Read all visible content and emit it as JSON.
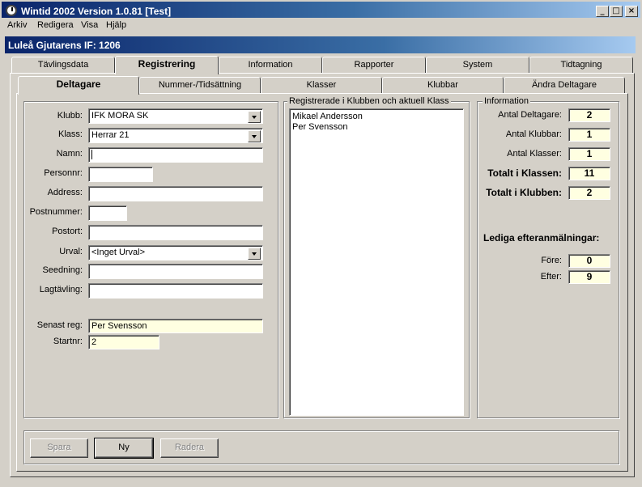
{
  "window": {
    "title": "Wintid 2002  Version 1.0.81 [Test]",
    "controls": {
      "minimize": "_",
      "maximize": "□",
      "close": "×"
    }
  },
  "menu": [
    "Arkiv",
    "Redigera",
    "Visa",
    "Hjälp"
  ],
  "club_header": "Luleå Gjutarens IF: 1206",
  "main_tabs": [
    "Tävlingsdata",
    "Registrering",
    "Information",
    "Rapporter",
    "System",
    "Tidtagning"
  ],
  "sub_tabs": [
    "Deltagare",
    "Nummer-/Tidsättning",
    "Klasser",
    "Klubbar",
    "Ändra Deltagare"
  ],
  "form": {
    "klubb_label": "Klubb:",
    "klubb_value": "IFK MORA SK",
    "klass_label": "Klass:",
    "klass_value": "Herrar 21",
    "namn_label": "Namn:",
    "namn_value": "",
    "personnr_label": "Personnr:",
    "personnr_value": "",
    "address_label": "Address:",
    "address_value": "",
    "postnummer_label": "Postnummer:",
    "postnummer_value": "",
    "postort_label": "Postort:",
    "postort_value": "",
    "urval_label": "Urval:",
    "urval_value": "<Inget Urval>",
    "seedning_label": "Seedning:",
    "seedning_value": "",
    "lagtavling_label": "Lagtävling:",
    "lagtavling_value": "",
    "senast_label": "Senast  reg:",
    "senast_value": "Per Svensson",
    "startnr_label": "Startnr:",
    "startnr_value": "2"
  },
  "registered": {
    "caption": "Registrerade i Klubben och aktuell Klass",
    "items": [
      "Mikael Andersson",
      "Per Svensson"
    ]
  },
  "info": {
    "caption": "Information",
    "antal_deltagare_label": "Antal Deltagare:",
    "antal_deltagare": "2",
    "antal_klubbar_label": "Antal Klubbar:",
    "antal_klubbar": "1",
    "antal_klasser_label": "Antal Klasser:",
    "antal_klasser": "1",
    "totalt_klassen_label": "Totalt i Klassen:",
    "totalt_klassen": "11",
    "totalt_klubben_label": "Totalt i Klubben:",
    "totalt_klubben": "2",
    "lediga_label": "Lediga efteranmälningar:",
    "fore_label": "Före:",
    "fore": "0",
    "efter_label": "Efter:",
    "efter": "9"
  },
  "buttons": {
    "spara": "Spara",
    "ny": "Ny",
    "radera": "Radera"
  }
}
